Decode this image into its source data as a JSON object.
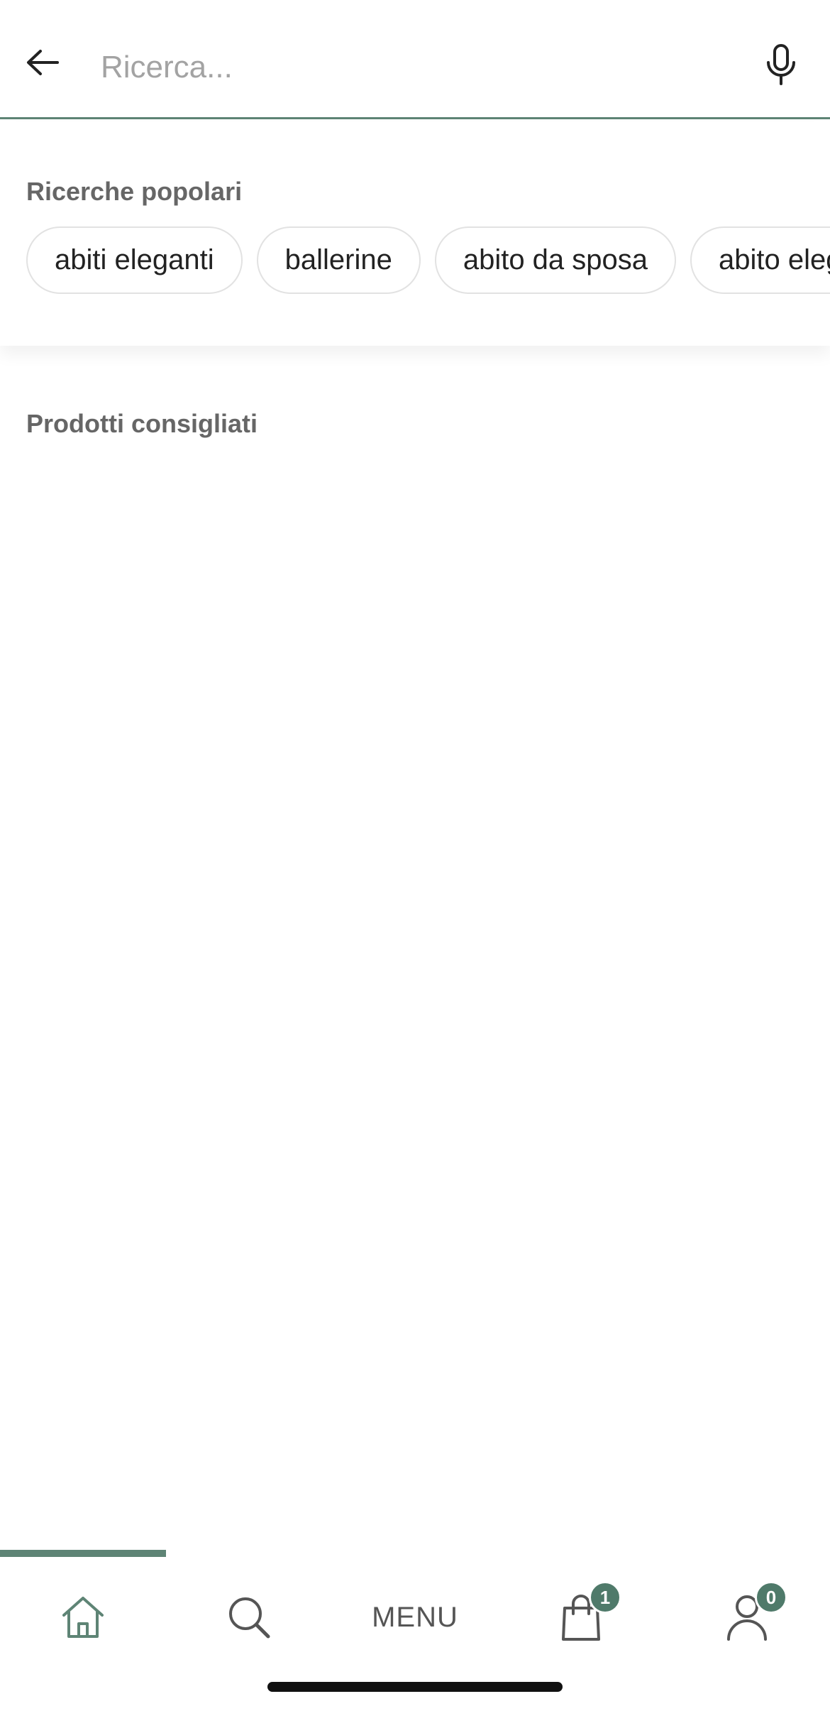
{
  "search": {
    "placeholder": "Ricerca...",
    "value": ""
  },
  "popular": {
    "title": "Ricerche popolari",
    "chips": [
      "abiti eleganti",
      "ballerine",
      "abito da sposa",
      "abito elegante"
    ]
  },
  "recommended": {
    "title": "Prodotti consigliati"
  },
  "bottom_nav": {
    "active": "home",
    "menu_label": "MENU",
    "cart_badge": "1",
    "account_badge": "0"
  },
  "colors": {
    "accent": "#5e8475",
    "badge": "#4f7a6a"
  },
  "icons": {
    "back": "arrow-left-icon",
    "mic": "microphone-icon",
    "home": "home-icon",
    "search": "search-icon",
    "cart": "shopping-bag-icon",
    "account": "user-icon"
  }
}
